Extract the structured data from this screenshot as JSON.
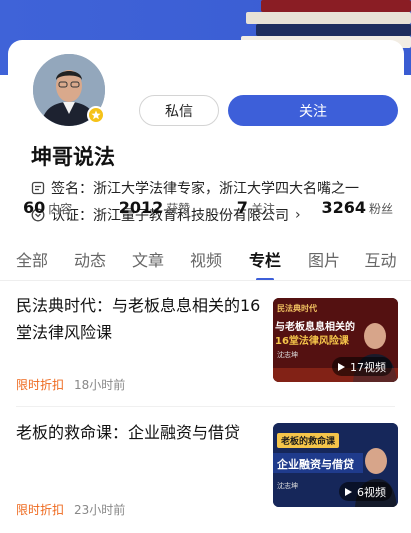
{
  "profile": {
    "name": "坤哥说法",
    "message_button": "私信",
    "follow_button": "关注",
    "signature_label": "签名：",
    "signature": "浙江大学法律专家，浙江大学四大名嘴之一",
    "certification_label": "认证：",
    "certification": "浙江量子教育科技股份有限公司"
  },
  "stats": [
    {
      "value": "60",
      "label": "内容"
    },
    {
      "value": "2012",
      "label": "获赞"
    },
    {
      "value": "7",
      "label": "关注"
    },
    {
      "value": "3264",
      "label": "粉丝"
    }
  ],
  "tabs": [
    "全部",
    "动态",
    "文章",
    "视频",
    "专栏",
    "图片",
    "互动"
  ],
  "active_tab": "专栏",
  "items": [
    {
      "title": "民法典时代：与老板息息相关的16堂法律风险课",
      "tag": "限时折扣",
      "time": "18小时前",
      "thumb_badge": "17视频",
      "thumb_lines": [
        "民法典时代",
        "与老板息息相关的",
        "16堂法律风险课",
        "沈志坤"
      ]
    },
    {
      "title": "老板的救命课：企业融资与借贷",
      "tag": "限时折扣",
      "time": "23小时前",
      "thumb_badge": "6视频",
      "thumb_lines": [
        "老板的救命课",
        "企业融资与借贷",
        "沈志坤"
      ]
    }
  ],
  "colors": {
    "accent": "#3d5fd9",
    "tag": "#ee6a1f",
    "header": "#3f63d8"
  }
}
